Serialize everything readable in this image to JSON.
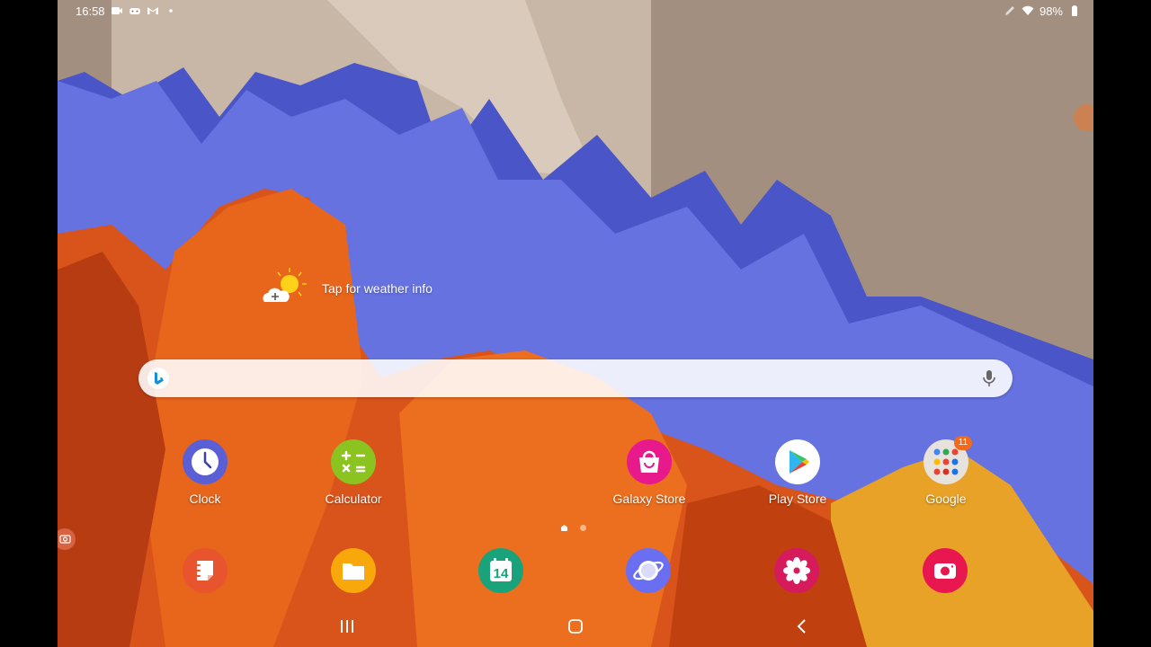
{
  "status_bar": {
    "time": "16:58",
    "left_icons": [
      "video-camera-icon",
      "gamepad-icon",
      "gmail-icon",
      "notification-dot-icon"
    ],
    "battery": "98%",
    "right_icons": [
      "pen-icon",
      "wifi-icon",
      "battery-icon"
    ]
  },
  "weather": {
    "label": "Tap for weather info",
    "icon": "weather-sun-cloud-icon"
  },
  "search": {
    "placeholder": "",
    "logo": "bing-logo-icon",
    "mic": "microphone-icon"
  },
  "apps": [
    {
      "label": "Clock",
      "icon": "clock-icon",
      "color": "#5a5fd6"
    },
    {
      "label": "Calculator",
      "icon": "calculator-icon",
      "color": "#8bc321"
    },
    {
      "label": "Galaxy Store",
      "icon": "shopping-bag-icon",
      "color": "#e8198b"
    },
    {
      "label": "Play Store",
      "icon": "play-store-icon",
      "color": "#ffffff"
    },
    {
      "label": "Google",
      "icon": "folder-icon",
      "color": "#e8e2dc",
      "badge": "11"
    }
  ],
  "pages": {
    "count": 2,
    "active": 1
  },
  "dock": [
    {
      "icon": "samsung-notes-icon",
      "color": "#e8542e"
    },
    {
      "icon": "my-files-icon",
      "color": "#f8a80b"
    },
    {
      "icon": "calendar-icon",
      "color": "#1aa37a",
      "text": "14"
    },
    {
      "icon": "samsung-internet-icon",
      "color": "#6a6ef0"
    },
    {
      "icon": "gallery-icon",
      "color": "#d61b5c"
    },
    {
      "icon": "camera-icon",
      "color": "#e8174f"
    }
  ],
  "nav": {
    "recents": "recents-icon",
    "home": "home-icon",
    "back": "back-icon"
  }
}
